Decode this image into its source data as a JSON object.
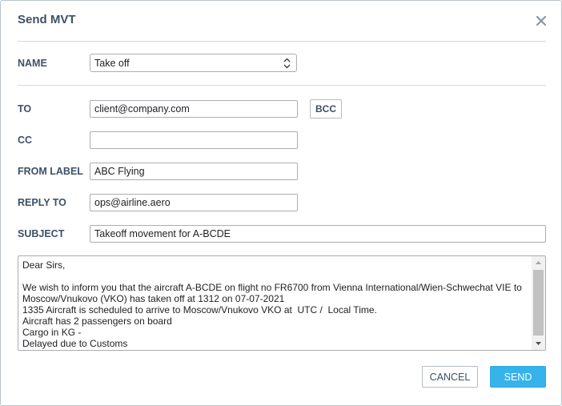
{
  "dialog": {
    "title": "Send MVT",
    "close_icon": "close-icon"
  },
  "form": {
    "name": {
      "label": "NAME",
      "selected": "Take off"
    },
    "to": {
      "label": "TO",
      "value": "client@company.com"
    },
    "bcc_label": "BCC",
    "cc": {
      "label": "CC",
      "value": ""
    },
    "from_label": {
      "label": "FROM LABEL",
      "value": "ABC Flying"
    },
    "reply_to": {
      "label": "REPLY TO",
      "value": "ops@airline.aero"
    },
    "subject": {
      "label": "SUBJECT",
      "value": "Takeoff movement for A-BCDE"
    },
    "message": "Dear Sirs,\n\nWe wish to inform you that the aircraft A-BCDE on flight no FR6700 from Vienna International/Wien-Schwechat VIE to Moscow/Vnukovo (VKO) has taken off at 1312 on 07-07-2021\n1335 Aircraft is scheduled to arrive to Moscow/Vnukovo VKO at  UTC /  Local Time.\nAircraft has 2 passengers on board\nCargo in KG -\nDelayed due to Customs"
  },
  "actions": {
    "cancel_label": "CANCEL",
    "send_label": "SEND"
  },
  "colors": {
    "title": "#3d5066",
    "send_button": "#36b3ea",
    "border": "#a9adb2"
  }
}
